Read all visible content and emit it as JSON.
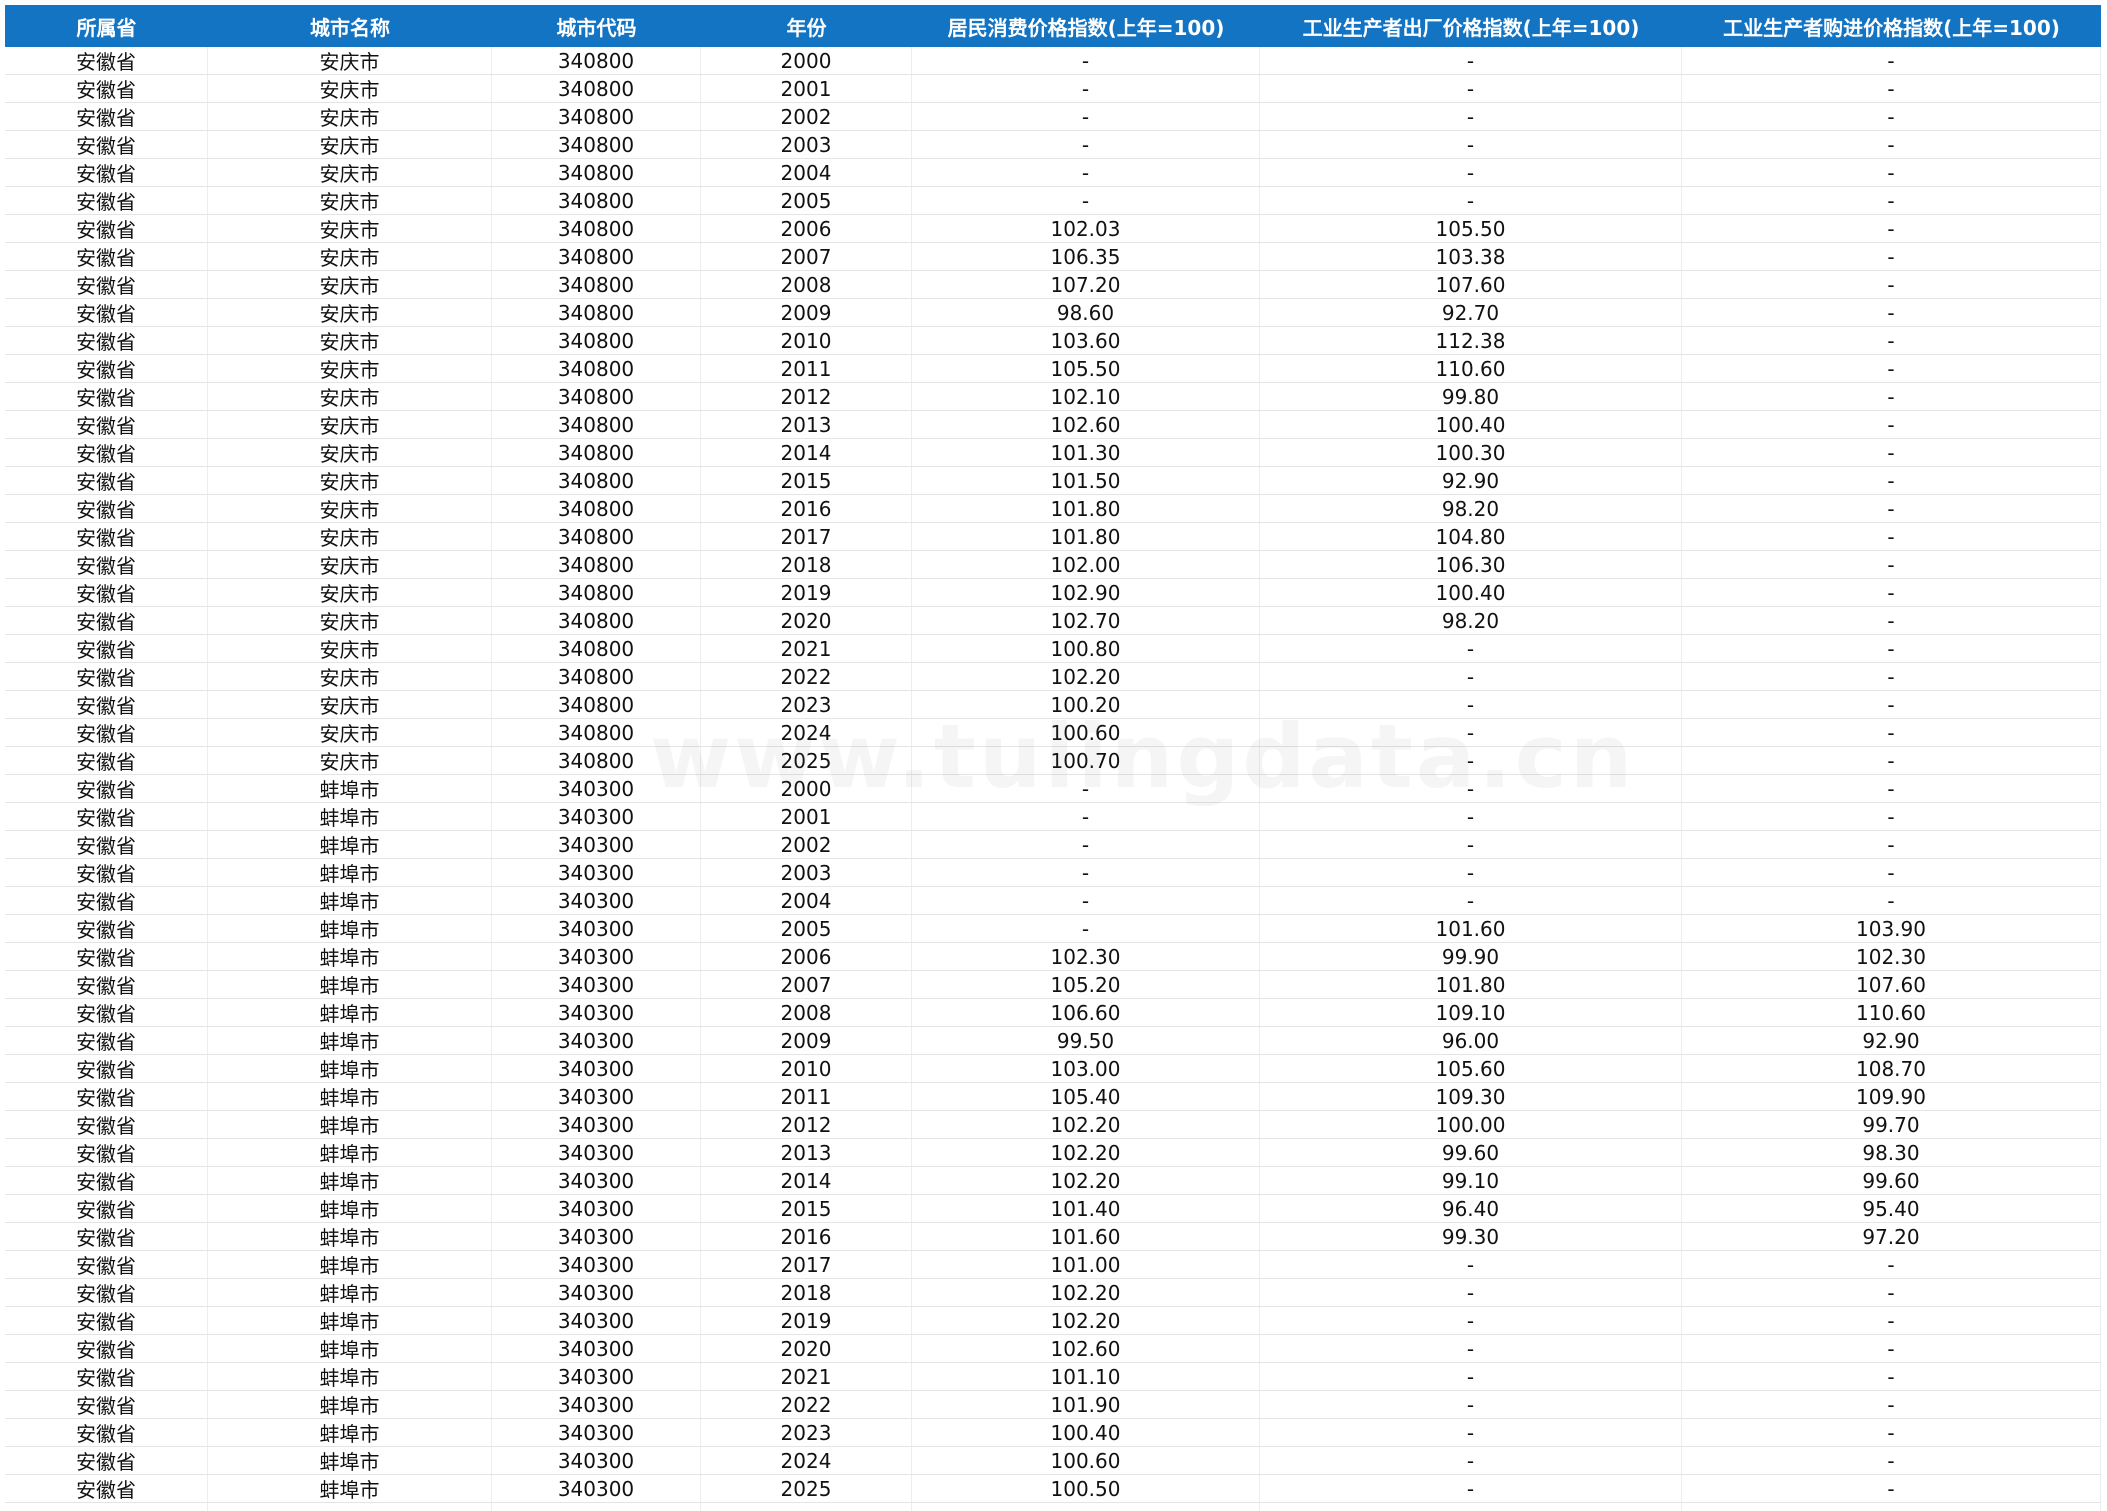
{
  "headers": [
    "所属省",
    "城市名称",
    "城市代码",
    "年份",
    "居民消费价格指数(上年=100)",
    "工业生产者出厂价格指数(上年=100)",
    "工业生产者购进价格指数(上年=100)"
  ],
  "watermark": "www.tulingdata.cn",
  "rows": [
    [
      "安徽省",
      "安庆市",
      "340800",
      "2000",
      "-",
      "-",
      "-"
    ],
    [
      "安徽省",
      "安庆市",
      "340800",
      "2001",
      "-",
      "-",
      "-"
    ],
    [
      "安徽省",
      "安庆市",
      "340800",
      "2002",
      "-",
      "-",
      "-"
    ],
    [
      "安徽省",
      "安庆市",
      "340800",
      "2003",
      "-",
      "-",
      "-"
    ],
    [
      "安徽省",
      "安庆市",
      "340800",
      "2004",
      "-",
      "-",
      "-"
    ],
    [
      "安徽省",
      "安庆市",
      "340800",
      "2005",
      "-",
      "-",
      "-"
    ],
    [
      "安徽省",
      "安庆市",
      "340800",
      "2006",
      "102.03",
      "105.50",
      "-"
    ],
    [
      "安徽省",
      "安庆市",
      "340800",
      "2007",
      "106.35",
      "103.38",
      "-"
    ],
    [
      "安徽省",
      "安庆市",
      "340800",
      "2008",
      "107.20",
      "107.60",
      "-"
    ],
    [
      "安徽省",
      "安庆市",
      "340800",
      "2009",
      "98.60",
      "92.70",
      "-"
    ],
    [
      "安徽省",
      "安庆市",
      "340800",
      "2010",
      "103.60",
      "112.38",
      "-"
    ],
    [
      "安徽省",
      "安庆市",
      "340800",
      "2011",
      "105.50",
      "110.60",
      "-"
    ],
    [
      "安徽省",
      "安庆市",
      "340800",
      "2012",
      "102.10",
      "99.80",
      "-"
    ],
    [
      "安徽省",
      "安庆市",
      "340800",
      "2013",
      "102.60",
      "100.40",
      "-"
    ],
    [
      "安徽省",
      "安庆市",
      "340800",
      "2014",
      "101.30",
      "100.30",
      "-"
    ],
    [
      "安徽省",
      "安庆市",
      "340800",
      "2015",
      "101.50",
      "92.90",
      "-"
    ],
    [
      "安徽省",
      "安庆市",
      "340800",
      "2016",
      "101.80",
      "98.20",
      "-"
    ],
    [
      "安徽省",
      "安庆市",
      "340800",
      "2017",
      "101.80",
      "104.80",
      "-"
    ],
    [
      "安徽省",
      "安庆市",
      "340800",
      "2018",
      "102.00",
      "106.30",
      "-"
    ],
    [
      "安徽省",
      "安庆市",
      "340800",
      "2019",
      "102.90",
      "100.40",
      "-"
    ],
    [
      "安徽省",
      "安庆市",
      "340800",
      "2020",
      "102.70",
      "98.20",
      "-"
    ],
    [
      "安徽省",
      "安庆市",
      "340800",
      "2021",
      "100.80",
      "-",
      "-"
    ],
    [
      "安徽省",
      "安庆市",
      "340800",
      "2022",
      "102.20",
      "-",
      "-"
    ],
    [
      "安徽省",
      "安庆市",
      "340800",
      "2023",
      "100.20",
      "-",
      "-"
    ],
    [
      "安徽省",
      "安庆市",
      "340800",
      "2024",
      "100.60",
      "-",
      "-"
    ],
    [
      "安徽省",
      "安庆市",
      "340800",
      "2025",
      "100.70",
      "-",
      "-"
    ],
    [
      "安徽省",
      "蚌埠市",
      "340300",
      "2000",
      "-",
      "-",
      "-"
    ],
    [
      "安徽省",
      "蚌埠市",
      "340300",
      "2001",
      "-",
      "-",
      "-"
    ],
    [
      "安徽省",
      "蚌埠市",
      "340300",
      "2002",
      "-",
      "-",
      "-"
    ],
    [
      "安徽省",
      "蚌埠市",
      "340300",
      "2003",
      "-",
      "-",
      "-"
    ],
    [
      "安徽省",
      "蚌埠市",
      "340300",
      "2004",
      "-",
      "-",
      "-"
    ],
    [
      "安徽省",
      "蚌埠市",
      "340300",
      "2005",
      "-",
      "101.60",
      "103.90"
    ],
    [
      "安徽省",
      "蚌埠市",
      "340300",
      "2006",
      "102.30",
      "99.90",
      "102.30"
    ],
    [
      "安徽省",
      "蚌埠市",
      "340300",
      "2007",
      "105.20",
      "101.80",
      "107.60"
    ],
    [
      "安徽省",
      "蚌埠市",
      "340300",
      "2008",
      "106.60",
      "109.10",
      "110.60"
    ],
    [
      "安徽省",
      "蚌埠市",
      "340300",
      "2009",
      "99.50",
      "96.00",
      "92.90"
    ],
    [
      "安徽省",
      "蚌埠市",
      "340300",
      "2010",
      "103.00",
      "105.60",
      "108.70"
    ],
    [
      "安徽省",
      "蚌埠市",
      "340300",
      "2011",
      "105.40",
      "109.30",
      "109.90"
    ],
    [
      "安徽省",
      "蚌埠市",
      "340300",
      "2012",
      "102.20",
      "100.00",
      "99.70"
    ],
    [
      "安徽省",
      "蚌埠市",
      "340300",
      "2013",
      "102.20",
      "99.60",
      "98.30"
    ],
    [
      "安徽省",
      "蚌埠市",
      "340300",
      "2014",
      "102.20",
      "99.10",
      "99.60"
    ],
    [
      "安徽省",
      "蚌埠市",
      "340300",
      "2015",
      "101.40",
      "96.40",
      "95.40"
    ],
    [
      "安徽省",
      "蚌埠市",
      "340300",
      "2016",
      "101.60",
      "99.30",
      "97.20"
    ],
    [
      "安徽省",
      "蚌埠市",
      "340300",
      "2017",
      "101.00",
      "-",
      "-"
    ],
    [
      "安徽省",
      "蚌埠市",
      "340300",
      "2018",
      "102.20",
      "-",
      "-"
    ],
    [
      "安徽省",
      "蚌埠市",
      "340300",
      "2019",
      "102.20",
      "-",
      "-"
    ],
    [
      "安徽省",
      "蚌埠市",
      "340300",
      "2020",
      "102.60",
      "-",
      "-"
    ],
    [
      "安徽省",
      "蚌埠市",
      "340300",
      "2021",
      "101.10",
      "-",
      "-"
    ],
    [
      "安徽省",
      "蚌埠市",
      "340300",
      "2022",
      "101.90",
      "-",
      "-"
    ],
    [
      "安徽省",
      "蚌埠市",
      "340300",
      "2023",
      "100.40",
      "-",
      "-"
    ],
    [
      "安徽省",
      "蚌埠市",
      "340300",
      "2024",
      "100.60",
      "-",
      "-"
    ],
    [
      "安徽省",
      "蚌埠市",
      "340300",
      "2025",
      "100.50",
      "-",
      "-"
    ]
  ]
}
